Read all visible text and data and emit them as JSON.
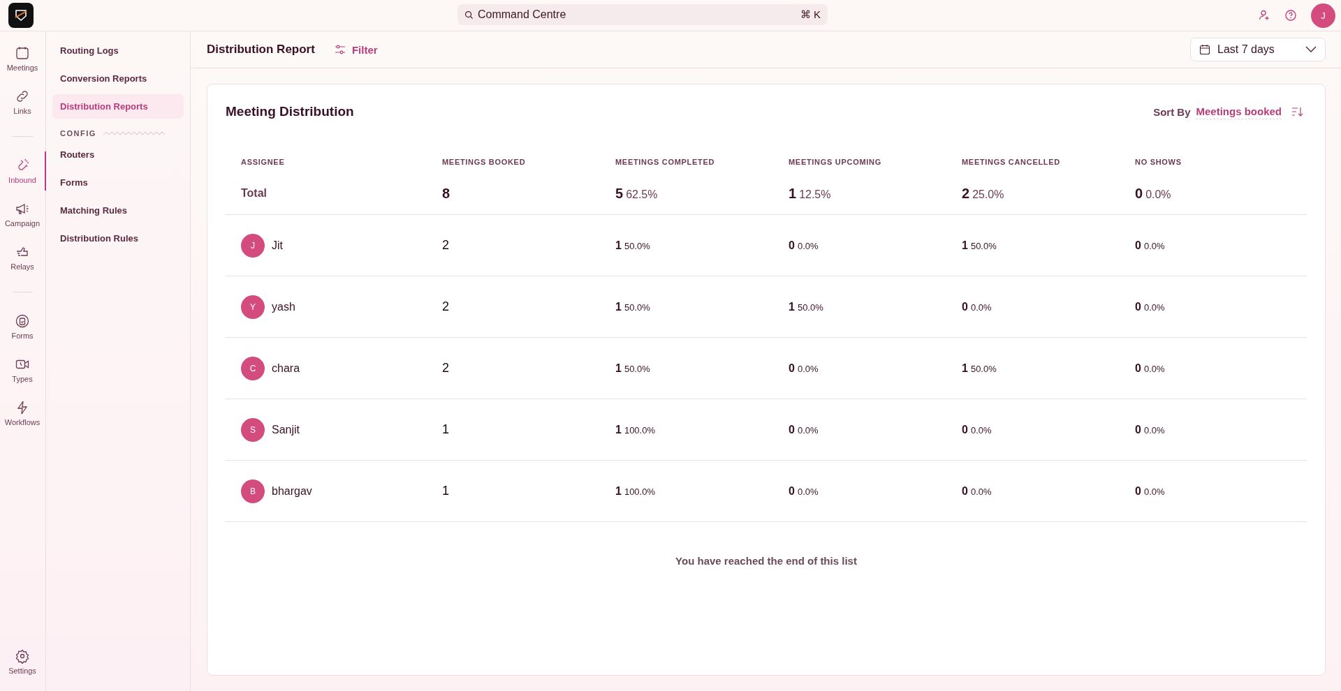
{
  "topbar": {
    "search": {
      "placeholder": "Command Centre",
      "shortcut": "⌘ K"
    },
    "avatar": "J"
  },
  "rail": {
    "groups": [
      {
        "items": [
          {
            "kind": "meetings",
            "label": "Meetings",
            "selected": false
          },
          {
            "kind": "links",
            "label": "Links",
            "selected": false
          }
        ]
      },
      {
        "items": [
          {
            "kind": "inbound",
            "label": "Inbound",
            "selected": true
          },
          {
            "kind": "campaign",
            "label": "Campaign",
            "selected": false
          },
          {
            "kind": "relays",
            "label": "Relays",
            "selected": false
          }
        ]
      },
      {
        "items": [
          {
            "kind": "forms",
            "label": "Forms",
            "selected": false
          },
          {
            "kind": "types",
            "label": "Types",
            "selected": false
          },
          {
            "kind": "workflows",
            "label": "Workflows",
            "selected": false
          }
        ]
      }
    ],
    "settings": {
      "kind": "settings",
      "label": "Settings",
      "selected": false
    }
  },
  "subnav": {
    "items": [
      {
        "label": "Routing Logs",
        "selected": false
      },
      {
        "label": "Conversion Reports",
        "selected": false
      },
      {
        "label": "Distribution Reports",
        "selected": true
      }
    ],
    "section": "CONFIG",
    "section_items": [
      {
        "label": "Routers",
        "selected": false
      },
      {
        "label": "Forms",
        "selected": false
      },
      {
        "label": "Matching Rules",
        "selected": false
      },
      {
        "label": "Distribution Rules",
        "selected": false
      }
    ]
  },
  "header": {
    "title": "Distribution Report",
    "filter": "Filter",
    "date_range": "Last 7 days"
  },
  "card": {
    "title": "Meeting Distribution",
    "sort_label": "Sort By",
    "sort_value": "Meetings booked",
    "columns": [
      "ASSIGNEE",
      "MEETINGS BOOKED",
      "MEETINGS COMPLETED",
      "MEETINGS UPCOMING",
      "MEETINGS CANCELLED",
      "NO SHOWS"
    ],
    "total": {
      "label": "Total",
      "booked": "8",
      "stats": [
        {
          "count": "5",
          "pct": "62.5%"
        },
        {
          "count": "1",
          "pct": "12.5%"
        },
        {
          "count": "2",
          "pct": "25.0%"
        },
        {
          "count": "0",
          "pct": "0.0%"
        }
      ]
    },
    "rows": [
      {
        "initial": "J",
        "name": "Jit",
        "booked": "2",
        "stats": [
          {
            "count": "1",
            "pct": "50.0%"
          },
          {
            "count": "0",
            "pct": "0.0%"
          },
          {
            "count": "1",
            "pct": "50.0%"
          },
          {
            "count": "0",
            "pct": "0.0%"
          }
        ]
      },
      {
        "initial": "Y",
        "name": "yash",
        "booked": "2",
        "stats": [
          {
            "count": "1",
            "pct": "50.0%"
          },
          {
            "count": "1",
            "pct": "50.0%"
          },
          {
            "count": "0",
            "pct": "0.0%"
          },
          {
            "count": "0",
            "pct": "0.0%"
          }
        ]
      },
      {
        "initial": "C",
        "name": "chara",
        "booked": "2",
        "stats": [
          {
            "count": "1",
            "pct": "50.0%"
          },
          {
            "count": "0",
            "pct": "0.0%"
          },
          {
            "count": "1",
            "pct": "50.0%"
          },
          {
            "count": "0",
            "pct": "0.0%"
          }
        ]
      },
      {
        "initial": "S",
        "name": "Sanjit",
        "booked": "1",
        "stats": [
          {
            "count": "1",
            "pct": "100.0%"
          },
          {
            "count": "0",
            "pct": "0.0%"
          },
          {
            "count": "0",
            "pct": "0.0%"
          },
          {
            "count": "0",
            "pct": "0.0%"
          }
        ]
      },
      {
        "initial": "B",
        "name": "bhargav",
        "booked": "1",
        "stats": [
          {
            "count": "1",
            "pct": "100.0%"
          },
          {
            "count": "0",
            "pct": "0.0%"
          },
          {
            "count": "0",
            "pct": "0.0%"
          },
          {
            "count": "0",
            "pct": "0.0%"
          }
        ]
      }
    ],
    "end_message": "You have reached the end of this list"
  }
}
